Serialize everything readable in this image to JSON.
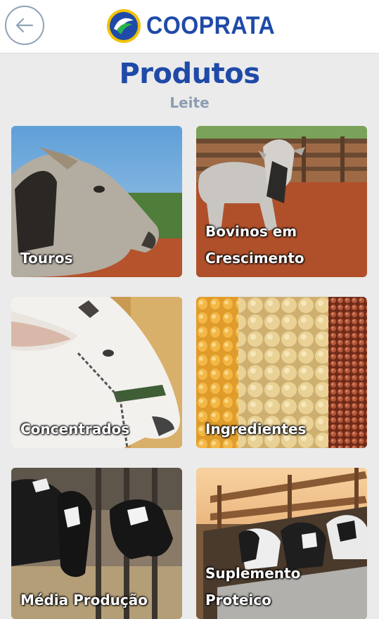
{
  "header": {
    "back_icon": "arrow-left-icon",
    "logo_text": "COOPRATA",
    "colors": {
      "brand_blue": "#1f4aa8",
      "logo_green": "#2bb24c",
      "logo_yellow": "#f2c200"
    }
  },
  "page": {
    "title": "Produtos",
    "subtitle": "Leite"
  },
  "products": [
    {
      "label": "Touros"
    },
    {
      "label": "Bovinos em\nCrescimento"
    },
    {
      "label": "Concentrados"
    },
    {
      "label": "Ingredientes"
    },
    {
      "label": "Média Produção"
    },
    {
      "label": "Suplemento\nProteico"
    }
  ]
}
